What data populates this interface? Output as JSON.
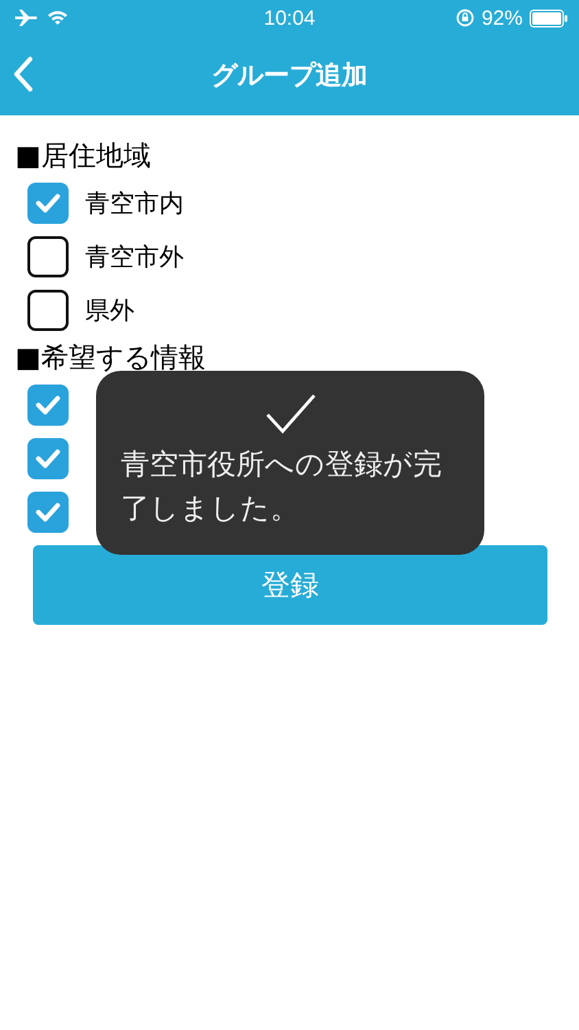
{
  "status_bar": {
    "time": "10:04",
    "battery": "92%"
  },
  "header": {
    "title": "グループ追加"
  },
  "sections": [
    {
      "heading": "■居住地域",
      "options": [
        {
          "label": "青空市内",
          "checked": true
        },
        {
          "label": "青空市外",
          "checked": false
        },
        {
          "label": "県外",
          "checked": false
        }
      ]
    },
    {
      "heading": "■希望する情報",
      "options": [
        {
          "checked": true
        },
        {
          "checked": true
        },
        {
          "checked": true
        }
      ]
    }
  ],
  "submit_button": "登録",
  "toast": {
    "message": "青空市役所への登録が完了しました。"
  }
}
